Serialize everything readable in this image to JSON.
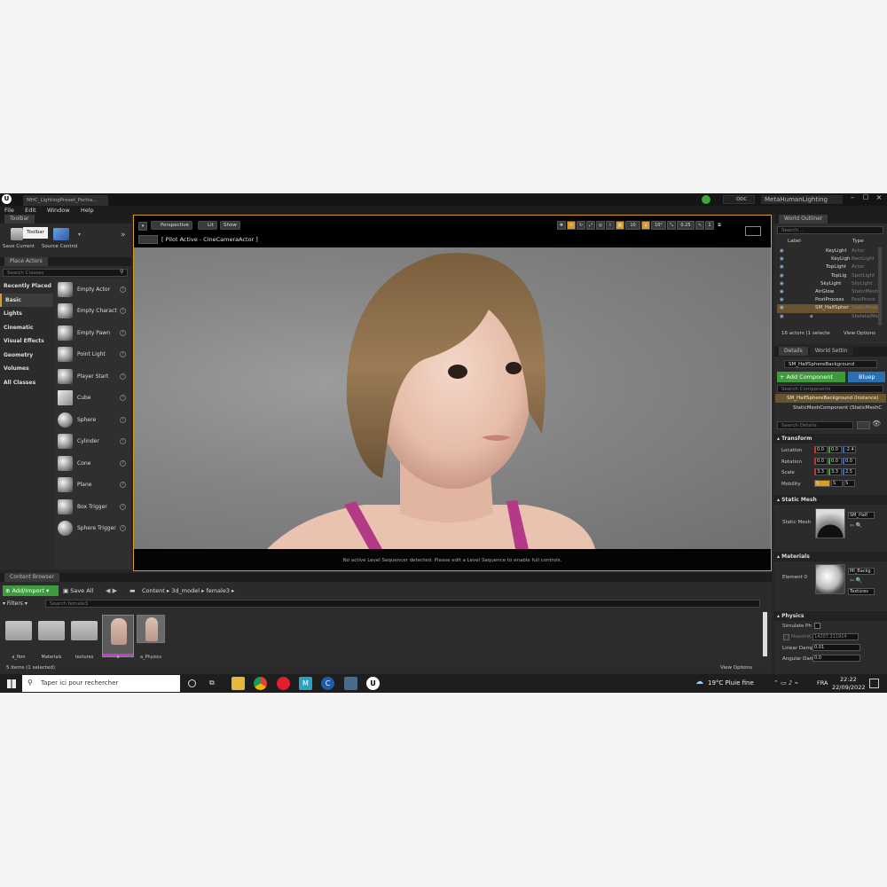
{
  "window": {
    "level_tab": "MHC_LightingPreset_Portra...",
    "ddc_label": "DDC",
    "project_name": "MetaHumanLighting"
  },
  "menu": [
    "File",
    "Edit",
    "Window",
    "Help"
  ],
  "toolbar": {
    "tab_label": "Toolbar",
    "tooltip": "Toolbar",
    "save_current": "Save Current",
    "source_control": "Source Control"
  },
  "place_actors": {
    "tab_label": "Place Actors",
    "search_placeholder": "Search Classes",
    "categories": [
      "Recently Placed",
      "Basic",
      "Lights",
      "Cinematic",
      "Visual Effects",
      "Geometry",
      "Volumes",
      "All Classes"
    ],
    "selected_category": "Basic",
    "items": [
      "Empty Actor",
      "Empty Charact",
      "Empty Pawn",
      "Point Light",
      "Player Start",
      "Cube",
      "Sphere",
      "Cylinder",
      "Cone",
      "Plane",
      "Box Trigger",
      "Sphere Trigger"
    ]
  },
  "viewport": {
    "perspective": "Perspective",
    "lit": "Lit",
    "show": "Show",
    "pilot": "[ Pilot Active - CineCameraActor ]",
    "grid_snap": "10",
    "rot_snap": "10°",
    "scale_snap": "0.25",
    "cam_speed": "1",
    "footer": "No active Level Sequencer detected. Please edit a Level Sequence to enable full controls."
  },
  "outliner": {
    "tab_label": "World Outliner",
    "search_placeholder": "Search...",
    "col_label": "Label",
    "col_type": "Type",
    "rows": [
      {
        "label": "KeyLight",
        "type": "Actor"
      },
      {
        "label": "KeyLigh",
        "type": "RectLight"
      },
      {
        "label": "TopLight",
        "type": "Actor"
      },
      {
        "label": "TopLig",
        "type": "SpotLight"
      },
      {
        "label": "SkyLight",
        "type": "SkyLight"
      },
      {
        "label": "AirGlow",
        "type": "StaticMesh"
      },
      {
        "label": "PostProcess",
        "type": "PostProce"
      },
      {
        "label": "SM_HalfSpher",
        "type": "StaticMesh"
      },
      {
        "label": "a",
        "type": "SkeletalMe"
      }
    ],
    "status": "16 actors (1 selecte",
    "view_options": "View Options"
  },
  "details": {
    "tab_details": "Details",
    "tab_world": "World Settin",
    "object_name": "SM_HalfSphereBackground",
    "add_component": "+ Add Component",
    "blueprint": "Bluep",
    "search_components": "Search Components",
    "instance": "SM_HalfSphereBackground (Instance)",
    "component": "StaticMeshComponent (StaticMeshC",
    "search_details": "Search Details",
    "transform": "Transform",
    "location_label": "Location",
    "location": [
      "0.0",
      "0.0",
      "-2.4"
    ],
    "rotation_label": "Rotation",
    "rotation": [
      "0.0",
      "0.0",
      "0.0"
    ],
    "scale_label": "Scale",
    "scale": [
      "3.3",
      "3.3",
      "2.5"
    ],
    "mobility_label": "Mobility",
    "mobility_options": [
      "S",
      "S",
      "S"
    ],
    "static_mesh_section": "Static Mesh",
    "static_mesh_label": "Static Mesh",
    "static_mesh_value": "SM_Half",
    "materials_section": "Materials",
    "element_label": "Element 0",
    "material_value": "MI_Backg",
    "textures": "Textures",
    "physics_section": "Physics",
    "simulate": "Simulate Ph",
    "mass_label": "MassInK",
    "mass_value": "14207.211914",
    "linear_label": "Linear Damp",
    "linear_value": "0.01",
    "angular_label": "Angular Dam",
    "angular_value": "0.0"
  },
  "content_browser": {
    "tab_label": "Content Browser",
    "add_import": "Add/Import",
    "save_all": "Save All",
    "path": [
      "Content",
      "3d_model",
      "female3"
    ],
    "filters": "Filters",
    "search_placeholder": "Search female3",
    "assets": [
      "a_fbm",
      "Materials",
      "textures",
      "a",
      "a_Physics"
    ],
    "status": "5 items (1 selected)",
    "view_options": "View Options"
  },
  "taskbar": {
    "search_placeholder": "Taper ici pour rechercher",
    "weather": "19°C  Pluie fine",
    "lang": "FRA",
    "time": "22:22",
    "date": "22/09/2022"
  },
  "colors": {
    "accent": "#d89b23",
    "selection": "#6a5430",
    "add_button": "#3d9a3d",
    "blueprint_button": "#2a6fb0"
  }
}
